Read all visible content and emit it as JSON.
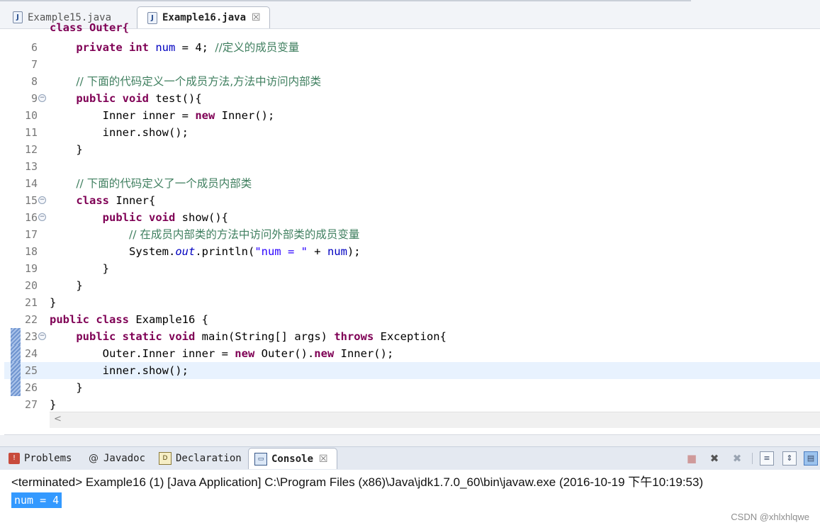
{
  "editor_tabs": [
    {
      "label": "Example15.java",
      "icon": "java-file-icon",
      "active": false
    },
    {
      "label": "Example16.java",
      "icon": "java-file-icon",
      "active": true
    }
  ],
  "editor": {
    "cut_off_top": "class Outer{",
    "current_line": 25,
    "lines": [
      {
        "num": "6"
      },
      {
        "num": "7"
      },
      {
        "num": "8"
      },
      {
        "num": "9"
      },
      {
        "num": "10"
      },
      {
        "num": "11"
      },
      {
        "num": "12"
      },
      {
        "num": "13"
      },
      {
        "num": "14"
      },
      {
        "num": "15"
      },
      {
        "num": "16"
      },
      {
        "num": "17"
      },
      {
        "num": "18"
      },
      {
        "num": "19"
      },
      {
        "num": "20"
      },
      {
        "num": "21"
      },
      {
        "num": "22"
      },
      {
        "num": "23"
      },
      {
        "num": "24"
      },
      {
        "num": "25"
      },
      {
        "num": "26"
      },
      {
        "num": "27"
      }
    ],
    "tokens": {
      "l6": [
        "private",
        "int",
        "num",
        " = 4; ",
        "//定义的成员变量"
      ],
      "l8": "// 下面的代码定义一个成员方法,方法中访问内部类",
      "l9": [
        "public",
        "void",
        " test(){"
      ],
      "l10": [
        "Inner inner = ",
        "new",
        " Inner();"
      ],
      "l11": "inner.show();",
      "l12": "}",
      "l14": "// 下面的代码定义了一个成员内部类",
      "l15": [
        "class",
        " Inner{"
      ],
      "l16": [
        "public",
        "void",
        " show(){"
      ],
      "l17": "// 在成员内部类的方法中访问外部类的成员变量",
      "l18": [
        "System.",
        "out",
        ".println(",
        "\"num = \"",
        " + ",
        "num",
        ");"
      ],
      "l19": "}",
      "l20": "}",
      "l21": "}",
      "l22": [
        "public",
        "class",
        " Example16 {"
      ],
      "l23": [
        "public",
        "static",
        "void",
        " main(String[] args) ",
        "throws",
        " Exception{"
      ],
      "l24": [
        "Outer.Inner inner = ",
        "new",
        " Outer().",
        "new",
        " Inner();"
      ],
      "l25": "inner.show();",
      "l26": "}",
      "l27": "}"
    },
    "hscroll_arrow": "<"
  },
  "view_tabs": [
    {
      "label": "Problems",
      "icon": "problems-icon"
    },
    {
      "label": "Javadoc",
      "icon": "javadoc-icon"
    },
    {
      "label": "Declaration",
      "icon": "declaration-icon"
    },
    {
      "label": "Console",
      "icon": "console-icon",
      "active": true
    }
  ],
  "console": {
    "header": "<terminated> Example16 (1) [Java Application] C:\\Program Files (x86)\\Java\\jdk1.7.0_60\\bin\\javaw.exe (2016-10-19 下午10:19:53)",
    "output": "num = 4"
  },
  "watermark": "CSDN @xhlxhlqwe",
  "colors": {
    "keyword": "#7f0055",
    "comment": "#3f7f5f",
    "field": "#0000c0",
    "string": "#2a00ff",
    "current_line": "#e8f2fe",
    "selection": "#3399ff"
  }
}
